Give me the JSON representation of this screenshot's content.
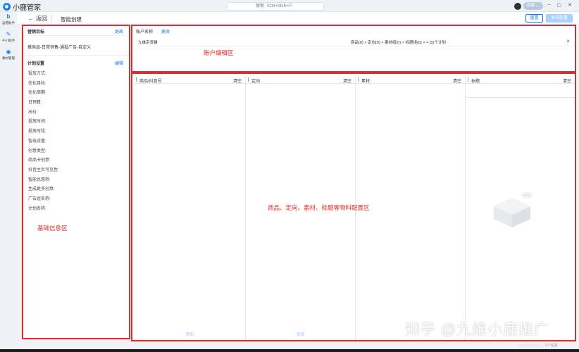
{
  "app": {
    "name": "小鹿管家"
  },
  "titlebar": {
    "search_text": "搜索（Ctrl+Shift+F）",
    "user_label": "旗舰",
    "minimize": "–",
    "maximize": "▢",
    "close": "✕"
  },
  "nav": {
    "items": [
      {
        "label": "运营助手",
        "icon": "b-logo-icon"
      },
      {
        "label": "千川助手",
        "icon": "feather-icon"
      },
      {
        "label": "素材管理",
        "icon": "circle-dot-icon"
      }
    ]
  },
  "header": {
    "back_label": "返回",
    "title": "智能创建",
    "reset_label": "重置",
    "publish_label": "发布配置"
  },
  "left_panel": {
    "marketing_goal_label": "营销目标",
    "marketing_goal_action": "更改",
    "marketing_goal_value": "推商品-日常销售-通投广告-自定义",
    "plan_settings_label": "计划设置",
    "plan_settings_action": "编辑",
    "fields": [
      "投放方式:",
      "优化目标:",
      "优化周期:",
      "日预算:",
      "出价:",
      "投放时间:",
      "投放时段:",
      "智选流量:",
      "创意类型:",
      "商品卡创意:",
      "抖音主页可见性:",
      "智能优惠券:",
      "生成更多创意:",
      "广告组名称:",
      "计划名称:"
    ],
    "zone_label": "基础信息区"
  },
  "account_panel": {
    "header_label": "账户名称",
    "header_action": "更改",
    "account_name": "九维京货铺",
    "account_stats": "商品(0) × 定向(0) × 素材组(0) × 标题组(0) × = (0)个计划",
    "zone_label": "账户编辑区"
  },
  "material_panel": {
    "columns": [
      {
        "title": "商品/抖音号",
        "clear": "清空",
        "add": "添加"
      },
      {
        "title": "定向",
        "clear": "清空",
        "add": "添加"
      },
      {
        "title": "素材",
        "clear": "清空",
        "add": ""
      },
      {
        "title": "标题",
        "clear": "清空",
        "add": ""
      }
    ],
    "zone_label": "商品、定向、素材、标题等物料配置区"
  },
  "footer": {
    "count_text": "0个任务"
  },
  "watermark": "知乎 @九维小鹿推广"
}
